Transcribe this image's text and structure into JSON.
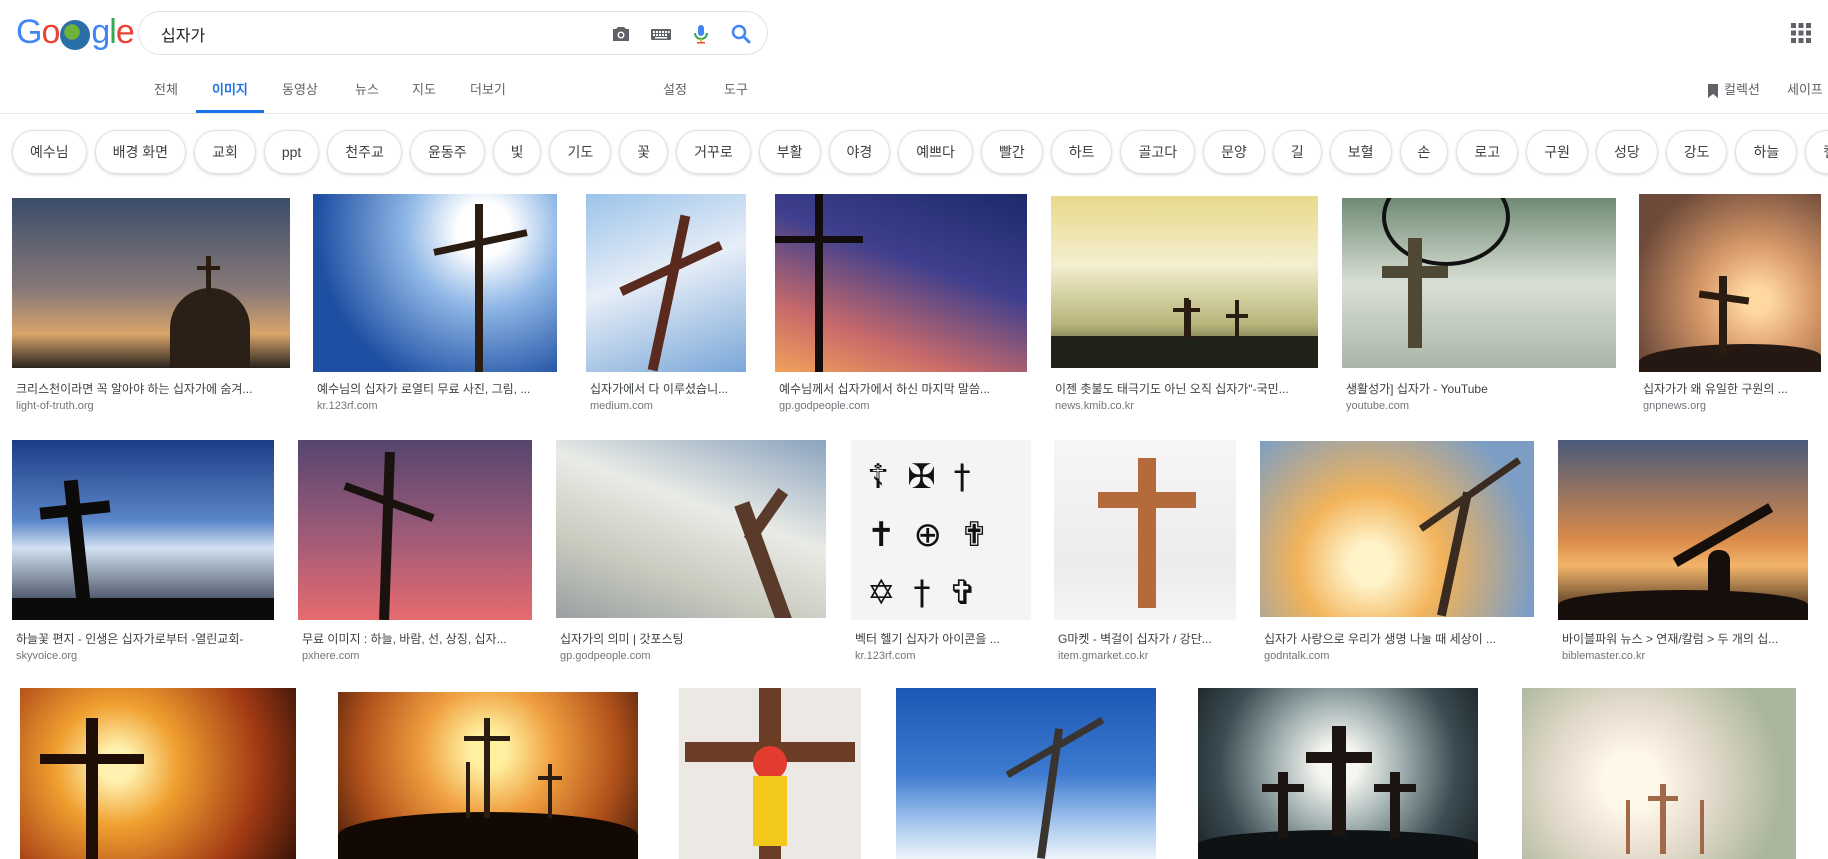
{
  "logo": {
    "text_g": "G",
    "text_o1": "o",
    "text_g2": "g",
    "text_l": "l",
    "text_e": "e",
    "alt": "Google"
  },
  "search": {
    "query": "십자가"
  },
  "tabs": [
    "전체",
    "이미지",
    "동영상",
    "뉴스",
    "지도",
    "더보기"
  ],
  "tools": {
    "settings": "설정",
    "tools": "도구"
  },
  "right": {
    "collections": "컬렉션",
    "safesearch": "세이프"
  },
  "chips": [
    "예수님",
    "배경 화면",
    "교회",
    "ppt",
    "천주교",
    "윤동주",
    "빛",
    "기도",
    "꽃",
    "거꾸로",
    "부활",
    "야경",
    "예쁘다",
    "빨간",
    "하트",
    "골고다",
    "문양",
    "길",
    "보혈",
    "손",
    "로고",
    "구원",
    "성당",
    "강도",
    "하늘",
    "켈트"
  ],
  "results": [
    {
      "caption": "크리스천이라면 꼭 알아야 하는 십자가에 숨겨...",
      "source": "light-of-truth.org"
    },
    {
      "caption": "예수님의 십자가 로열티 무료 사진, 그림, ...",
      "source": "kr.123rf.com"
    },
    {
      "caption": "십자가에서 다 이루셨습니...",
      "source": "medium.com"
    },
    {
      "caption": "예수님께서 십자가에서 하신 마지막 말씀...",
      "source": "gp.godpeople.com"
    },
    {
      "caption": "이젠 촛불도 태극기도 아닌 오직 십자가\"-국민...",
      "source": "news.kmib.co.kr"
    },
    {
      "caption": "생활성가] 십자가 - YouTube",
      "source": "youtube.com"
    },
    {
      "caption": "십자가가 왜 유일한 구원의 ...",
      "source": "gnpnews.org"
    },
    {
      "caption": "하늘꽃 편지 - 인생은 십자가로부터 -열린교회-",
      "source": "skyvoice.org"
    },
    {
      "caption": "무료 이미지 : 하늘, 바람, 선, 상징, 십자...",
      "source": "pxhere.com"
    },
    {
      "caption": "십자가의 의미 | 갓포스팅",
      "source": "gp.godpeople.com"
    },
    {
      "caption": "벡터 헬기 십자가 아이콘을 ...",
      "source": "kr.123rf.com"
    },
    {
      "caption": "G마켓 - 벽걸이 십자가 / 강단...",
      "source": "item.gmarket.co.kr"
    },
    {
      "caption": "십자가 사랑으로 우리가 생명 나눌 때 세상이 ...",
      "source": "godntalk.com"
    },
    {
      "caption": "바이블파워 뉴스 > 연재/칼럼 > 두 개의 십...",
      "source": "biblemaster.co.kr"
    }
  ],
  "icons": {
    "camera": "camera-icon",
    "keyboard": "keyboard-icon",
    "mic": "mic-icon",
    "search": "search-icon",
    "apps": "apps-grid-icon",
    "bookmark": "bookmark-icon"
  }
}
